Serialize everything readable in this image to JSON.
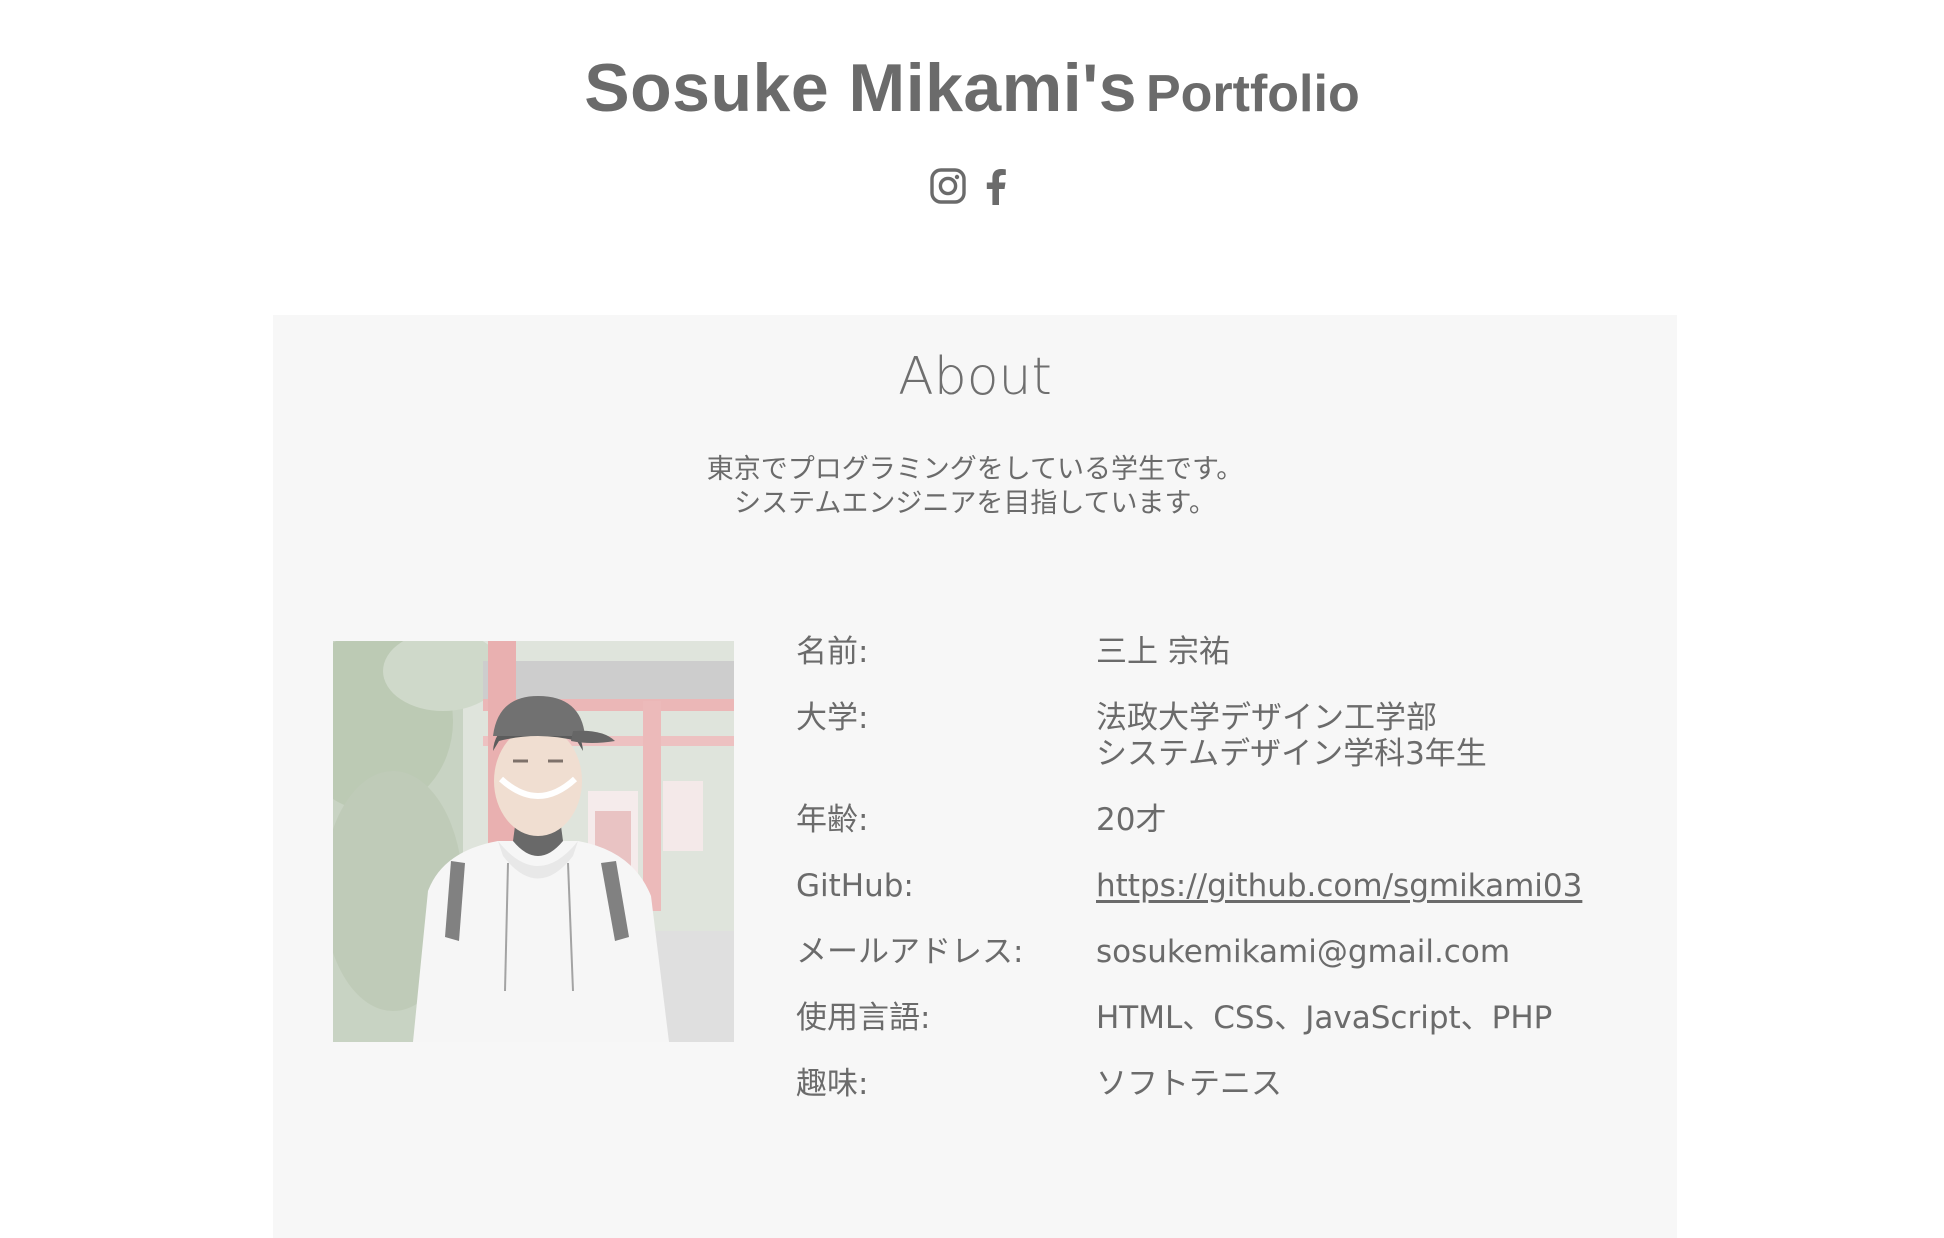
{
  "header": {
    "title_name": "Sosuke Mikami's",
    "title_suffix": "Portfolio",
    "social": [
      {
        "icon": "instagram-icon",
        "label": "Instagram"
      },
      {
        "icon": "facebook-icon",
        "label": "Facebook"
      }
    ]
  },
  "about": {
    "heading": "About",
    "intro_line1": "東京でプログラミングをしている学生です。",
    "intro_line2": "システムエンジニアを目指しています。",
    "photo_icon": "profile-photo",
    "profile": {
      "name_label": "名前:",
      "name_value": "三上 宗祐",
      "university_label": "大学:",
      "university_value_line1": "法政大学デザイン工学部",
      "university_value_line2": "システムデザイン学科3年生",
      "age_label": "年齢:",
      "age_value": "20才",
      "github_label": "GitHub:",
      "github_value": "https://github.com/sgmikami03",
      "email_label": "メールアドレス:",
      "email_value": "sosukemikami@gmail.com",
      "languages_label": "使用言語:",
      "languages_value": "HTML、CSS、JavaScript、PHP",
      "hobby_label": "趣味:",
      "hobby_value": "ソフトテニス"
    }
  },
  "colors": {
    "text": "#6b6b6b",
    "section_background": "#f7f7f7",
    "page_background": "#ffffff"
  }
}
